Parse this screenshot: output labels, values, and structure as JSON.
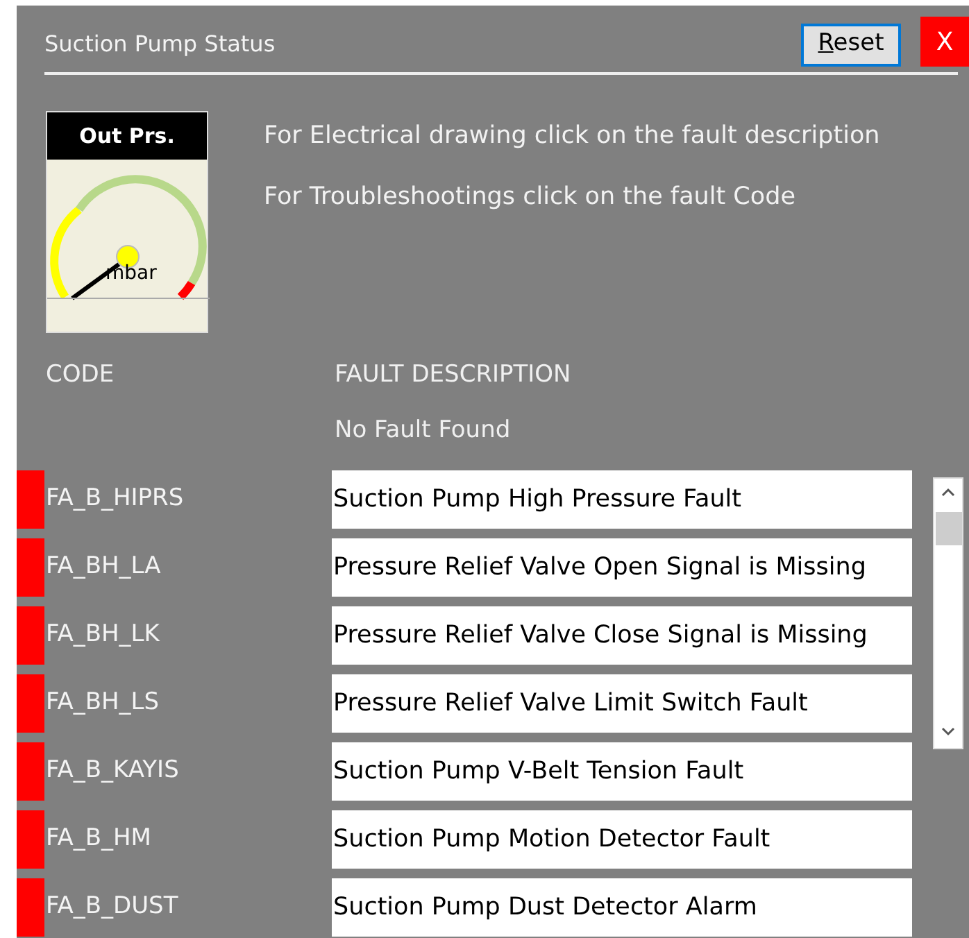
{
  "window": {
    "title": "Suction Pump Status",
    "reset_button": "Reset",
    "close_button": "X"
  },
  "gauge": {
    "title": "Out Prs.",
    "unit": "mbar"
  },
  "instructions": [
    "For Electrical drawing click on the fault description",
    "For Troubleshootings click on the fault Code"
  ],
  "columns": [
    "CODE",
    "FAULT DESCRIPTION"
  ],
  "status_message": "No Fault Found",
  "faults": [
    {
      "code": "FA_B_HIPRS",
      "description": "Suction Pump High Pressure Fault",
      "active": true
    },
    {
      "code": "FA_BH_LA",
      "description": "Pressure Relief Valve Open Signal is Missing",
      "active": true
    },
    {
      "code": "FA_BH_LK",
      "description": "Pressure Relief Valve Close Signal is Missing",
      "active": true
    },
    {
      "code": "FA_BH_LS",
      "description": "Pressure Relief Valve Limit Switch Fault",
      "active": true
    },
    {
      "code": "FA_B_KAYIS",
      "description": "Suction Pump V-Belt Tension Fault",
      "active": true
    },
    {
      "code": "FA_B_HM",
      "description": "Suction Pump Motion Detector Fault",
      "active": true
    },
    {
      "code": "FA_B_DUST",
      "description": "Suction Pump Dust Detector Alarm",
      "active": true
    }
  ]
}
